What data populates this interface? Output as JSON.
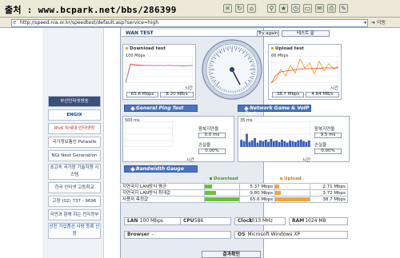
{
  "browser": {
    "watermark": "출처 : www.bcpark.net/bbs/286399",
    "address": "http://speed.nia.or.kr/speedtest/default.asp?service=high",
    "go_label": "이동"
  },
  "sidebar": {
    "items": [
      {
        "label": "부산인터넷방송"
      },
      {
        "label": "ENGIX"
      },
      {
        "label": "IPv6 차세대 인터넷망"
      },
      {
        "label": "국가정보통신 Potwalle"
      },
      {
        "label": "NGI Next Generation"
      },
      {
        "label": "초고속 국가망 기술지원 시스템"
      },
      {
        "label": "한국 인터넷 고등학교"
      },
      {
        "label": "고장 (02) 737 - 9696"
      },
      {
        "label": "국민과 함께 하는 전자정부"
      },
      {
        "label": "선진 가입품선 사랑 등록 신청"
      }
    ]
  },
  "speedtest": {
    "title": "WAN TEST",
    "try_again": "Try again",
    "test_button": "테스트 끝",
    "download": {
      "title": "Download test",
      "scale": "100 Mbps",
      "time_label": "시간",
      "max": "65.6 Mbps",
      "avg": "8.20 MB/s"
    },
    "upload": {
      "title": "Upload test",
      "scale": "68 Mbps",
      "time_label": "시간",
      "max": "38.7 Mbps",
      "avg": "4.84 MB/s"
    },
    "ping_section": "General Ping Test",
    "voip_section": "Network Game & VoIP Test",
    "ping": {
      "scale": "500 ms",
      "time_label": "시간",
      "rtt_label": "왕복지연율",
      "rtt": "0.0 ms",
      "loss_label": "손실율",
      "loss": "0.00%"
    },
    "voip": {
      "scale": "35 ms",
      "time_label": "시간",
      "rtt_label": "왕복지연율",
      "rtt": "9.5 ms",
      "loss_label": "손실율",
      "loss": "0.00%"
    },
    "bandwidth_section": "Bandwidth Gauge",
    "bandwidth": {
      "download_header": "Download",
      "upload_header": "Upload",
      "rows": [
        {
          "label": "지연국지 LAN방식 평균",
          "download": "5.37 Mbps",
          "download_fill": 0.2,
          "upload": "2.71 Mbps",
          "upload_fill": 0.12
        },
        {
          "label": "지연국지 LAN방식 최대값",
          "download": "9.80 Mbps",
          "download_fill": 0.32,
          "upload": "3.72 Mbps",
          "upload_fill": 0.16
        },
        {
          "label": "사용자 측정값",
          "download": "65.6 Mbps",
          "download_fill": 1.0,
          "upload": "38.7 Mbps",
          "upload_fill": 1.0
        }
      ]
    },
    "system": {
      "lan_label": "LAN",
      "lan": "100 Mbps",
      "cpu_label": "CPU",
      "cpu": "586",
      "clock_label": "Clock",
      "clock": "3013 MHz",
      "ram_label": "RAM",
      "ram": "1024 MB",
      "browser_label": "Browser",
      "browser": "-",
      "os_label": "OS",
      "os": "Microsoft Windows XP"
    },
    "result_button": "결과확인"
  },
  "colors": {
    "download": "#e0472f",
    "download_avg": "#7a9be0",
    "upload": "#f2a233",
    "voip": "#3a5bb8",
    "section_bar": "#4a74c1"
  },
  "chart_data": [
    {
      "type": "line",
      "series": [
        {
          "values": [
            0,
            70,
            68,
            66,
            65,
            65,
            64,
            65,
            64,
            65,
            64,
            64,
            63,
            64,
            64
          ]
        },
        {
          "values": [
            0,
            64,
            64,
            64,
            64,
            64,
            64,
            64,
            64,
            64,
            64,
            64,
            64,
            64,
            64
          ]
        }
      ],
      "ylim": [
        0,
        100
      ]
    },
    {
      "type": "line",
      "series": [
        {
          "values": [
            0,
            10,
            35,
            18,
            45,
            25,
            60,
            38,
            50,
            22,
            55,
            30,
            48,
            35,
            42
          ]
        },
        {
          "values": [
            0,
            20,
            28,
            30,
            32,
            33,
            35,
            36,
            36,
            37,
            37,
            38,
            38,
            38,
            38
          ]
        }
      ],
      "ylim": [
        0,
        68
      ]
    },
    {
      "type": "bar",
      "values": [
        0,
        0,
        0,
        0,
        0,
        0,
        0,
        0,
        0,
        0
      ],
      "ylim": [
        0,
        500
      ]
    },
    {
      "type": "bar",
      "values": [
        10,
        8,
        18,
        7,
        9,
        12,
        6,
        9,
        8,
        10,
        7,
        11,
        8,
        9,
        7,
        10,
        8,
        6,
        9,
        8,
        7,
        9,
        10,
        8,
        7,
        9
      ],
      "ylim": [
        0,
        35
      ]
    }
  ]
}
